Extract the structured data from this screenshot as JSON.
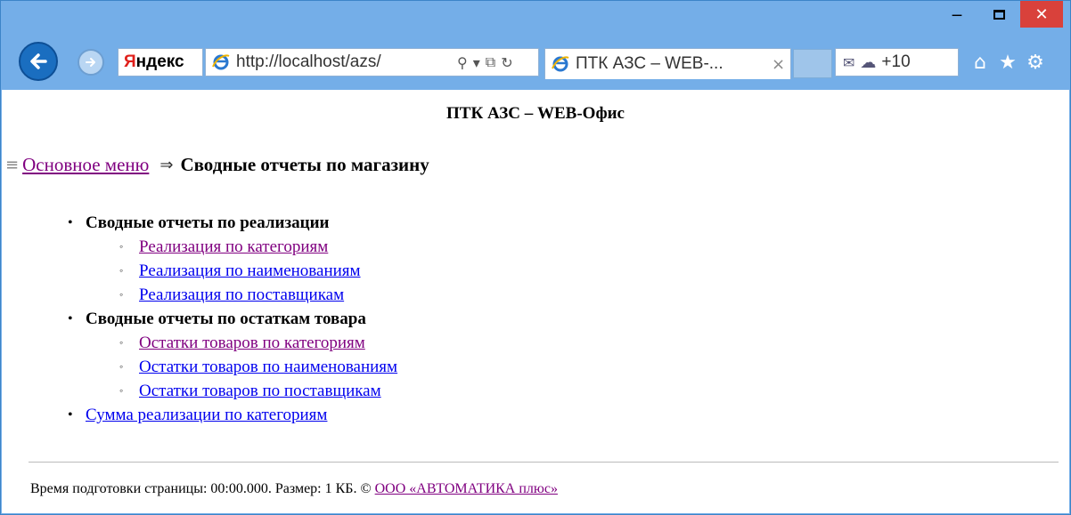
{
  "browser": {
    "search_brand": "Яндекс",
    "address": "http://localhost/azs/",
    "tab_title": "ПТК АЗС – WEB-...",
    "weather": "+10",
    "colors": {
      "chrome": "#74aee8",
      "close_button": "#d9413b",
      "back_button": "#1a6ec0"
    }
  },
  "page": {
    "title": "ПТК АЗС – WEB-Офис",
    "breadcrumb": {
      "home": "Основное меню",
      "current": "Сводные отчеты по магазину"
    },
    "groups": [
      {
        "label": "Сводные отчеты по реализации",
        "items": [
          {
            "label": "Реализация по категориям",
            "visited": true
          },
          {
            "label": "Реализация по наименованиям",
            "visited": false
          },
          {
            "label": "Реализация по поставщикам",
            "visited": false
          }
        ]
      },
      {
        "label": "Сводные отчеты по остаткам товара",
        "items": [
          {
            "label": "Остатки товаров по категориям",
            "visited": true
          },
          {
            "label": "Остатки товаров по наименованиям",
            "visited": false
          },
          {
            "label": "Остатки товаров по поставщикам",
            "visited": false
          }
        ]
      }
    ],
    "extra_link": "Сумма реализации по категориям",
    "footer": {
      "text": "Время подготовки страницы: 00:00.000. Размер: 1 КБ. © ",
      "company": "ООО «АВТОМАТИКА плюс»"
    }
  }
}
